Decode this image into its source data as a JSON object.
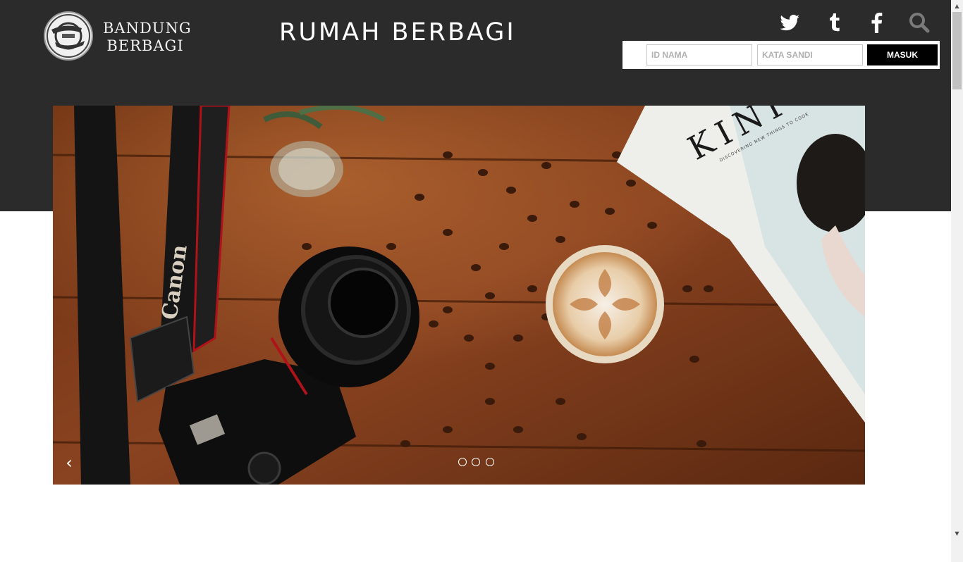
{
  "header": {
    "logo_lines": [
      "BANDUNG",
      "BERBAGI"
    ],
    "site_title": "RUMAH BERBAGI",
    "social": [
      "twitter-icon",
      "tumblr-icon",
      "facebook-icon",
      "search-icon"
    ]
  },
  "login": {
    "username_placeholder": "ID NAMA",
    "password_placeholder": "KATA SANDI",
    "submit_label": "MASUK"
  },
  "slider": {
    "prev_label": "‹",
    "slide_count": 3,
    "image_text": {
      "magazine_title": "KINF",
      "magazine_tagline": "DISCOVERING NEW THINGS TO COOK",
      "strap_brand": "Canon"
    }
  },
  "scrollbar": {
    "up": "▲",
    "down": "▼"
  },
  "colors": {
    "header_bg": "#2b2b2b",
    "button_bg": "#000000",
    "page_bg": "#ffffff"
  }
}
